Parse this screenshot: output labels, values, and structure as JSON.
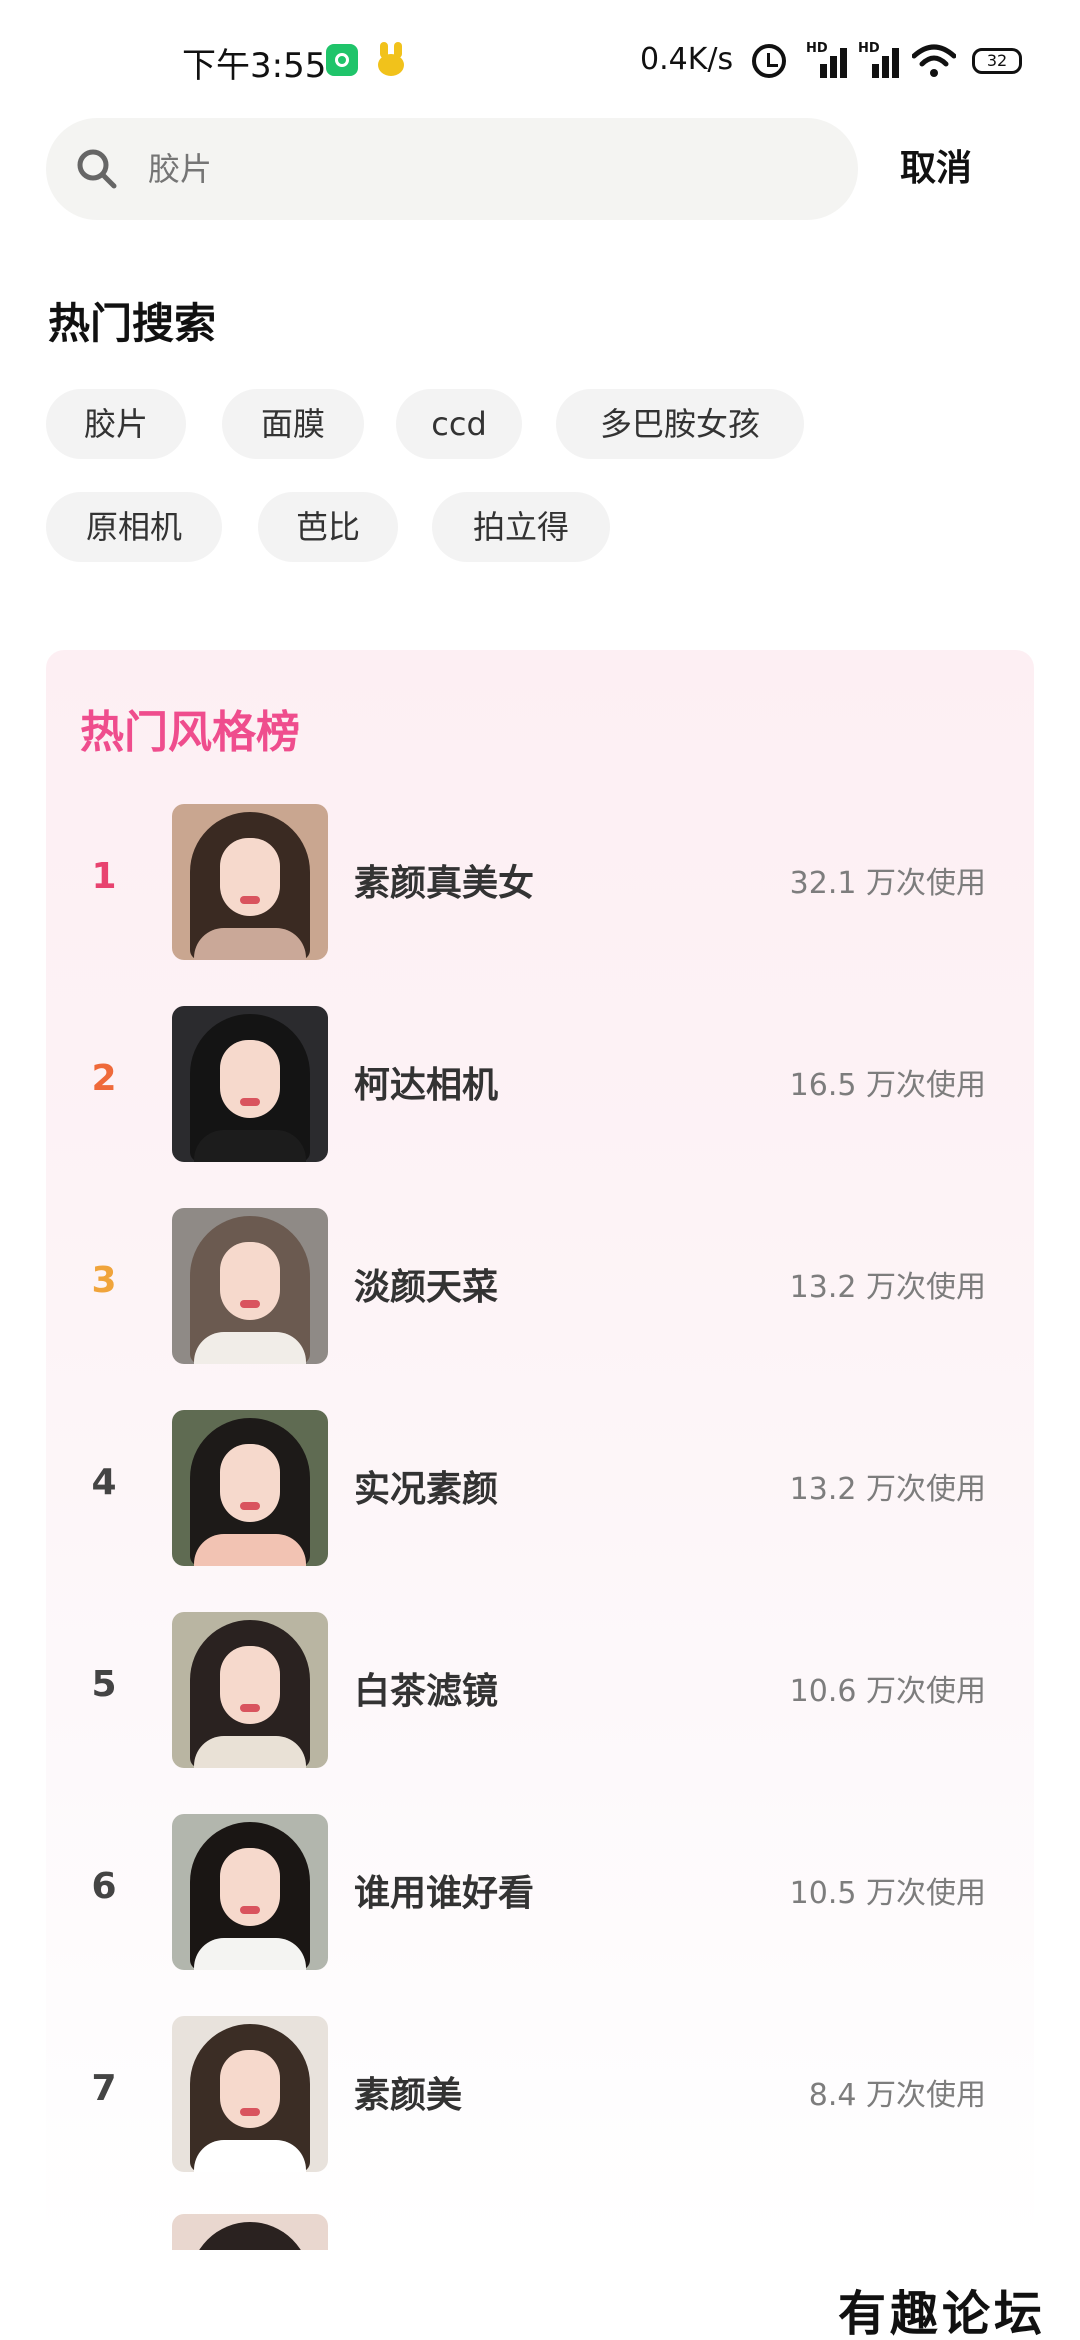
{
  "status_bar": {
    "time": "下午3:55",
    "net_speed": "0.4K/s",
    "signal_label": "HD",
    "battery": "32"
  },
  "search": {
    "placeholder": "胶片",
    "cancel_label": "取消"
  },
  "hot_search": {
    "title": "热门搜索",
    "tags": [
      "胶片",
      "面膜",
      "ccd",
      "多巴胺女孩",
      "原相机",
      "芭比",
      "拍立得"
    ]
  },
  "ranking": {
    "title": "热门风格榜",
    "items": [
      {
        "rank": "1",
        "name": "素颜真美女",
        "usage": "32.1 万次使用",
        "rank_color": "#e8436f"
      },
      {
        "rank": "2",
        "name": "柯达相机",
        "usage": "16.5 万次使用",
        "rank_color": "#ef6a3a"
      },
      {
        "rank": "3",
        "name": "淡颜天菜",
        "usage": "13.2 万次使用",
        "rank_color": "#f0a43b"
      },
      {
        "rank": "4",
        "name": "实况素颜",
        "usage": "13.2 万次使用",
        "rank_color": "#444444"
      },
      {
        "rank": "5",
        "name": "白茶滤镜",
        "usage": "10.6 万次使用",
        "rank_color": "#444444"
      },
      {
        "rank": "6",
        "name": "谁用谁好看",
        "usage": "10.5 万次使用",
        "rank_color": "#444444"
      },
      {
        "rank": "7",
        "name": "素颜美",
        "usage": "8.4 万次使用",
        "rank_color": "#444444"
      }
    ]
  },
  "watermark": "有趣论坛",
  "colors": {
    "accent_pink": "#ef4d8d",
    "search_bg": "#f4f4f2",
    "chip_bg": "#f3f3f3"
  }
}
